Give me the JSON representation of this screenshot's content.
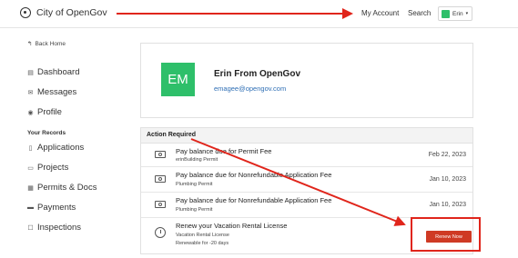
{
  "header": {
    "brand": "City of OpenGov",
    "my_account": "My Account",
    "search": "Search",
    "user": "Erin"
  },
  "sidebar": {
    "back_home": "Back Home",
    "items": [
      {
        "label": "Dashboard",
        "icon": "dashboard-icon"
      },
      {
        "label": "Messages",
        "icon": "messages-icon"
      },
      {
        "label": "Profile",
        "icon": "profile-icon"
      }
    ],
    "section_title": "Your Records",
    "records": [
      {
        "label": "Applications",
        "icon": "document-icon"
      },
      {
        "label": "Projects",
        "icon": "folder-icon"
      },
      {
        "label": "Permits & Docs",
        "icon": "permit-icon"
      },
      {
        "label": "Payments",
        "icon": "card-icon"
      },
      {
        "label": "Inspections",
        "icon": "inspection-icon"
      }
    ]
  },
  "profile": {
    "initials": "EM",
    "name": "Erin From OpenGov",
    "email": "emagee@opengov.com"
  },
  "actions": {
    "title": "Action Required",
    "rows": [
      {
        "title": "Pay balance due for Permit Fee",
        "sub": "erinBuilding Permit",
        "date": "Feb 22, 2023"
      },
      {
        "title": "Pay balance due for Nonrefundable Application Fee",
        "sub": "Plumbing Permit",
        "date": "Jan 10, 2023"
      },
      {
        "title": "Pay balance due for Nonrefundable Application Fee",
        "sub": "Plumbing Permit",
        "date": "Jan 10, 2023"
      }
    ],
    "renew": {
      "title": "Renew your Vacation Rental License",
      "sub": "Vacation Rental License",
      "sub2": "Renewable for -20 days",
      "button": "Renew Now"
    }
  },
  "colors": {
    "accent_green": "#2ebf6a",
    "renew_red": "#cf3a24",
    "annotation_red": "#e0251b",
    "link_blue": "#2f6fb5"
  }
}
